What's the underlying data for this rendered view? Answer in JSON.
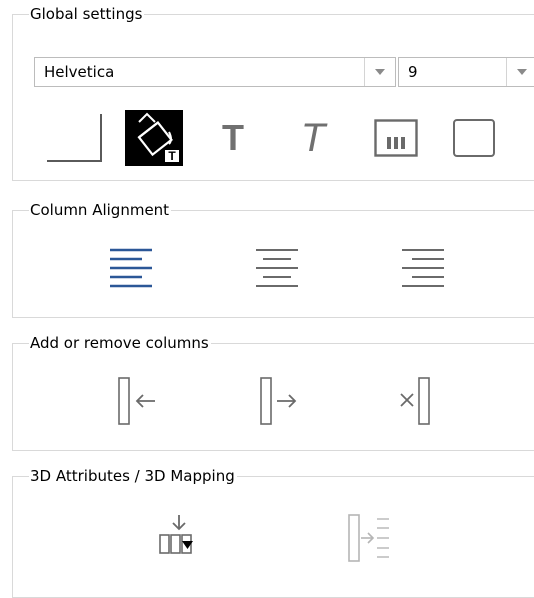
{
  "global_settings": {
    "title": "Global settings",
    "font_family": "Helvetica",
    "font_size": "9",
    "text_T": "T"
  },
  "column_alignment": {
    "title": "Column Alignment"
  },
  "columns": {
    "title": "Add or remove columns"
  },
  "attributes_3d": {
    "title": "3D Attributes / 3D Mapping"
  },
  "colors": {
    "accent_blue": "#2b5797",
    "icon_gray": "#7a7a7a",
    "disabled_gray": "#b5b5b5",
    "border": "#d9d9d9"
  },
  "icons": [
    "border-icon",
    "fill-color-icon",
    "bold-icon",
    "italic-icon",
    "column-lines-icon",
    "frame-icon",
    "align-left-icon",
    "align-center-icon",
    "align-right-icon",
    "insert-column-left-icon",
    "insert-column-right-icon",
    "remove-column-icon",
    "3d-mapping-icon",
    "3d-attributes-icon"
  ]
}
